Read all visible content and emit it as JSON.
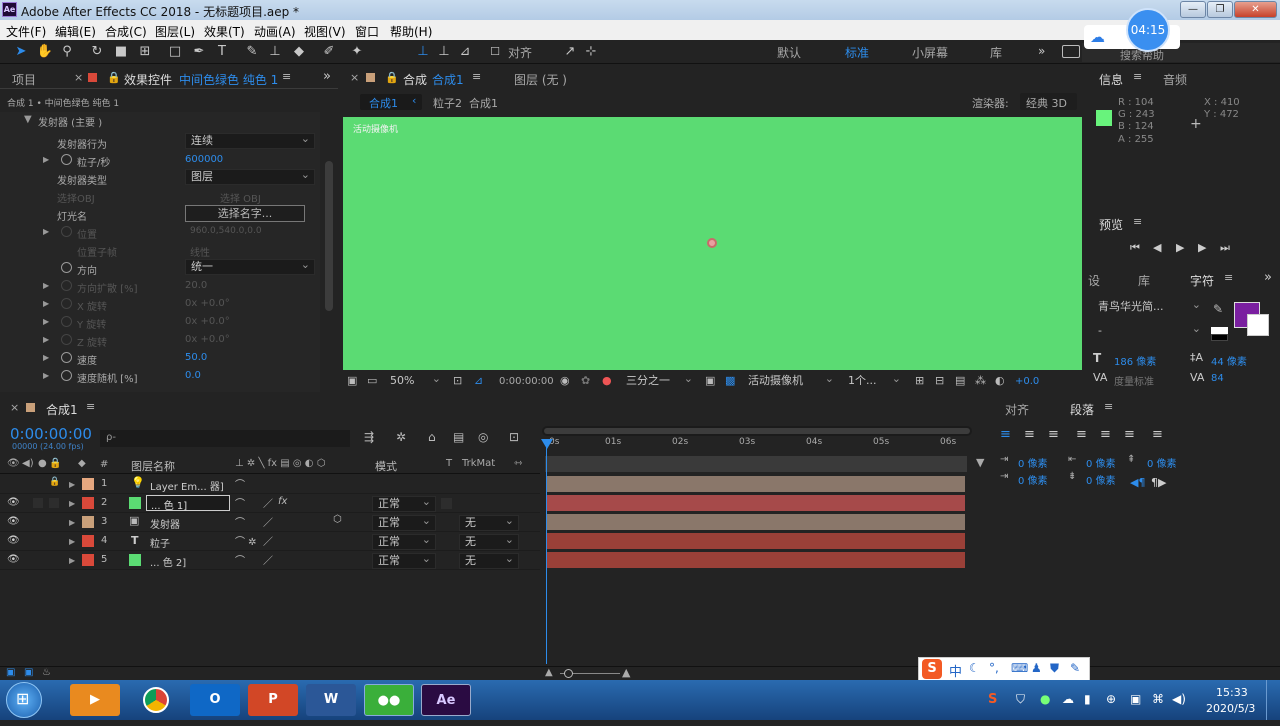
{
  "window": {
    "app_icon": "Ae",
    "title": "Adobe After Effects CC 2018 - 无标题项目.aep *",
    "minimize": "—",
    "restore": "❐",
    "close": "✕"
  },
  "menu": [
    "文件(F)",
    "编辑(E)",
    "合成(C)",
    "图层(L)",
    "效果(T)",
    "动画(A)",
    "视图(V)",
    "窗口",
    "帮助(H)"
  ],
  "toolbar": {
    "snap_label": "对齐",
    "workspaces": [
      "默认",
      "标准",
      "小屏幕",
      "库"
    ],
    "active_workspace": "标准",
    "search_placeholder": "搜索帮助",
    "recording_time": "04:15"
  },
  "effects_panel": {
    "tab_project": "项目",
    "tab_effects": "效果控件",
    "layer_name": "中间色绿色 纯色 1",
    "breadcrumb": "合成 1 • 中间色绿色 纯色 1",
    "section": "发射器  (主要  )",
    "props": [
      {
        "name": "发射器行为",
        "value": "连续",
        "kind": "dropdown"
      },
      {
        "name": "粒子/秒",
        "value": "600000",
        "kind": "number"
      },
      {
        "name": "发射器类型",
        "value": "图层",
        "kind": "dropdown"
      },
      {
        "name": "选择OBJ",
        "value": "选择 OBJ",
        "kind": "disabled"
      },
      {
        "name": "灯光名",
        "value": "选择名字...",
        "kind": "button"
      },
      {
        "name": "位置",
        "value": "960.0,540.0,0.0",
        "kind": "disabled"
      },
      {
        "name": "位置子帧",
        "value": "线性",
        "kind": "disabled"
      },
      {
        "name": "方向",
        "value": "统一",
        "kind": "dropdown"
      },
      {
        "name": "方向扩散 [%]",
        "value": "20.0",
        "kind": "disabled"
      },
      {
        "name": "X 旋转",
        "value": "0x +0.0°",
        "kind": "disabled"
      },
      {
        "name": "Y 旋转",
        "value": "0x +0.0°",
        "kind": "disabled"
      },
      {
        "name": "Z 旋转",
        "value": "0x +0.0°",
        "kind": "disabled"
      },
      {
        "name": "速度",
        "value": "50.0",
        "kind": "number"
      },
      {
        "name": "速度随机 [%]",
        "value": "0.0",
        "kind": "number"
      }
    ]
  },
  "viewer": {
    "tab_comp": "合成",
    "comp_name": "合成1",
    "tab_layer": "图层  (无  )",
    "crumb_1": "合成1",
    "crumb_2": "粒子2",
    "crumb_2_comp": "合成1",
    "renderer_label": "渲染器:",
    "renderer_value": "经典 3D",
    "camera_overlay": "活动摄像机",
    "canvas_color": "#5bdb73",
    "zoom": "50%",
    "timecode": "0:00:00:00",
    "resolution": "三分之一",
    "view_camera": "活动摄像机",
    "views": "1个...",
    "exposure": "+0.0"
  },
  "info_panel": {
    "tab_info": "信息",
    "tab_audio": "音频",
    "swatch": "#68f37c",
    "r": "R : 104",
    "g": "G : 243",
    "b": "B : 124",
    "a": "A : 255",
    "x": "X : 410",
    "y": "Y : 472"
  },
  "preview_panel": {
    "title": "预览"
  },
  "char_panel": {
    "tab_settings": "设",
    "tab_library": "库",
    "tab_char": "字符",
    "font_name": "青鸟华光简...",
    "font_style": "-",
    "font_size": "186 像素",
    "leading": "44 像素",
    "kerning": "度量标准",
    "tracking": "84",
    "fill_color": "#7a1fa0"
  },
  "paragraph_panel": {
    "tab_align": "对齐",
    "tab_para": "段落",
    "indent_left": "0 像素",
    "indent_right": "0 像素",
    "space_before": "0 像素",
    "first_indent": "0 像素",
    "space_after": "0 像素"
  },
  "timeline": {
    "tab": "合成1",
    "timecode": "0:00:00:00",
    "fps": "00000 (24.00 fps)",
    "search_placeholder": "ρ-",
    "col_num": "#",
    "col_name": "图层名称",
    "col_mode": "模式",
    "col_t": "T",
    "col_trkmat": "TrkMat",
    "ruler": [
      "0s",
      "01s",
      "02s",
      "03s",
      "04s",
      "05s",
      "06s"
    ],
    "layers": [
      {
        "num": "1",
        "name": "Layer Em... 器]",
        "color": "#e5a77f",
        "mode": "",
        "trk": "",
        "bar": "#8a776a",
        "icon": "light"
      },
      {
        "num": "2",
        "name": "... 色 1]",
        "color": "#5bdb73",
        "mode": "正常",
        "trk": "",
        "bar": "#a64a4a",
        "icon": "solid"
      },
      {
        "num": "3",
        "name": "发射器",
        "color": "#c9a07a",
        "mode": "正常",
        "trk": "无",
        "bar": "#8a776a",
        "icon": "precomp"
      },
      {
        "num": "4",
        "name": "粒子",
        "color": "#d9493a",
        "mode": "正常",
        "trk": "无",
        "bar": "#9a4038",
        "icon": "text"
      },
      {
        "num": "5",
        "name": "... 色 2]",
        "color": "#5bdb73",
        "mode": "正常",
        "trk": "无",
        "bar": "#9a4038",
        "icon": "solid"
      }
    ]
  },
  "taskbar": {
    "clock_time": "15:33",
    "clock_date": "2020/5/3",
    "ime_text": "中",
    "apps": [
      "start",
      "player",
      "chrome",
      "outlook",
      "powerpoint",
      "word",
      "wechat",
      "aftereffects"
    ]
  }
}
